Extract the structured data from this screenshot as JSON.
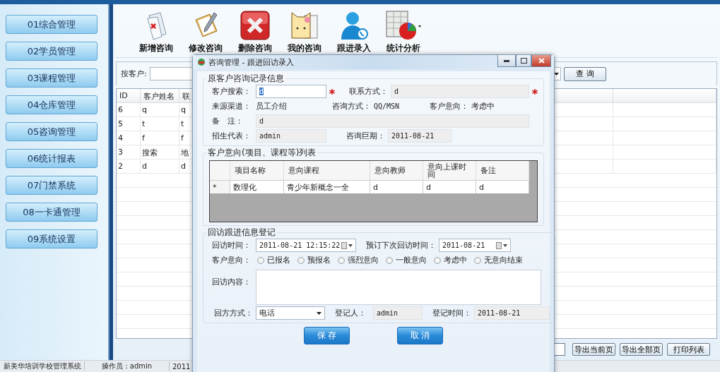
{
  "sidebar": {
    "items": [
      "01综合管理",
      "02学员管理",
      "03课程管理",
      "04仓库管理",
      "05咨询管理",
      "06统计报表",
      "07门禁系统",
      "08一卡通管理",
      "09系统设置"
    ]
  },
  "toolbar": {
    "buttons": [
      {
        "label": "新增咨询",
        "kind": "add"
      },
      {
        "label": "修改咨询",
        "kind": "edit"
      },
      {
        "label": "删除咨询",
        "kind": "delete"
      },
      {
        "label": "我的咨询",
        "kind": "mine"
      },
      {
        "label": "跟进录入",
        "kind": "follow"
      },
      {
        "label": "统计分析",
        "kind": "stats"
      }
    ]
  },
  "search": {
    "label": "按客户:",
    "button": "查 询"
  },
  "table": {
    "columns": [
      "ID",
      "客户姓名",
      "联"
    ],
    "rows": [
      [
        "6",
        "q",
        "q"
      ],
      [
        "5",
        "t",
        "t"
      ],
      [
        "4",
        "f",
        "f"
      ],
      [
        "3",
        "搜索",
        "地"
      ],
      [
        "2",
        "d",
        "d"
      ]
    ]
  },
  "footer_buttons": [
    "导出当前页",
    "导出全部页",
    "打印列表"
  ],
  "status_bar": [
    "新美华培训学校管理系统",
    "操作员：admin",
    "2011"
  ],
  "dialog": {
    "title": "咨询管理 - 跟进回访录入",
    "original_record": {
      "title": "原客户咨询记录信息",
      "customer_search": {
        "label": "客户搜索：",
        "value": "d",
        "readonly": false,
        "required": true
      },
      "contact": {
        "label": "联系方式：",
        "value": "d",
        "readonly": true,
        "required": true
      },
      "source": {
        "label": "来源渠道：",
        "value": "员工介绍"
      },
      "method": {
        "label": "咨询方式：",
        "value": "QQ/MSN"
      },
      "intent": {
        "label": "客户意向：",
        "value": "考虑中"
      },
      "remarks": {
        "label": "备　注：",
        "value": "d",
        "readonly": true
      },
      "rep": {
        "label": "招生代表：",
        "value": "admin",
        "readonly": true
      },
      "date": {
        "label": "咨询巨期：",
        "value": "2011-08-21",
        "readonly": true
      }
    },
    "intent_grid": {
      "title": "客户意向(项目、课程等)列表",
      "columns": [
        "项目名称",
        "意向课程",
        "意向教师",
        "意向上课时间",
        "备注"
      ],
      "rows": [
        {
          "marker": "*",
          "cells": [
            "数理化",
            "青少年新概念一全",
            "d",
            "d",
            "d"
          ]
        }
      ]
    },
    "follow_up": {
      "title": "回访跟进信息登记",
      "visit_time": {
        "label": "回访时间：",
        "value": "2011-08-21 12:15:22"
      },
      "next_time": {
        "label": "预订下次回访时间：",
        "value": "2011-08-21"
      },
      "intent": {
        "label": "客户意向：",
        "options": [
          {
            "label": "已报名",
            "selected": false
          },
          {
            "label": "预报名",
            "selected": false
          },
          {
            "label": "强烈意向",
            "selected": false
          },
          {
            "label": "一般意向",
            "selected": false
          },
          {
            "label": "考虑中",
            "selected": false
          },
          {
            "label": "无意向结束",
            "selected": false
          }
        ]
      },
      "content": {
        "label": "回访内容："
      },
      "method": {
        "label": "回方方式：",
        "value": "电话"
      },
      "registrar": {
        "label": "登记人：",
        "value": "admin",
        "readonly": true
      },
      "reg_time": {
        "label": "登记时间：",
        "value": "2011-08-21",
        "readonly": true
      }
    },
    "buttons": [
      "保 存",
      "取 消"
    ]
  }
}
